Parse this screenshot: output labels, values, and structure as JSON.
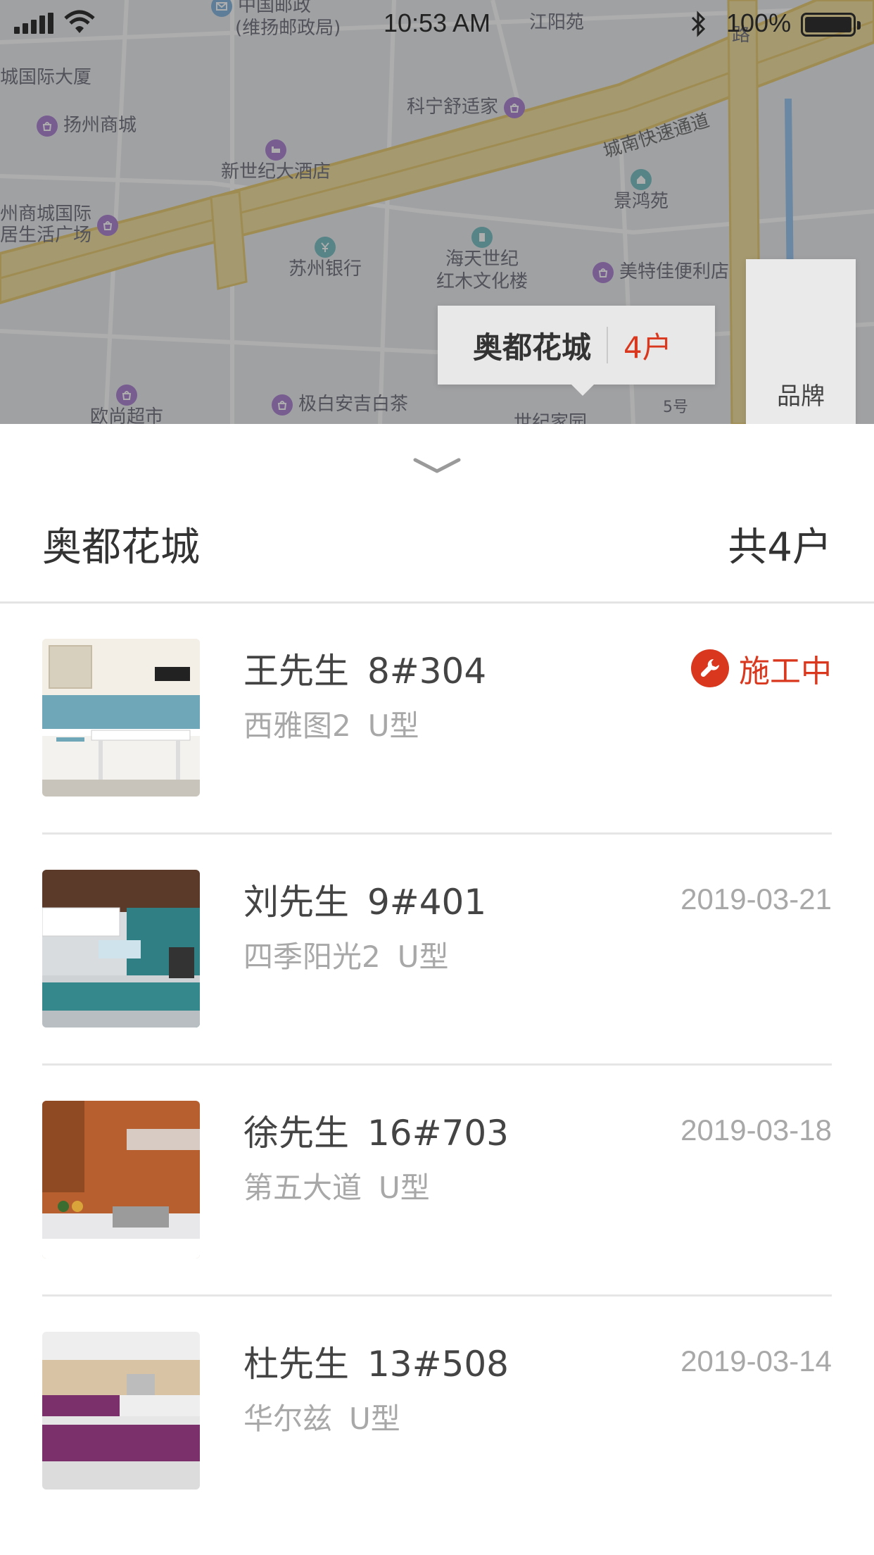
{
  "status_bar": {
    "time": "10:53 AM",
    "battery": "100%"
  },
  "map": {
    "pois": [
      {
        "label": "中国邮政",
        "label2": "(维扬邮政局)",
        "icon": "mail-icon"
      },
      {
        "label": "江阳苑"
      },
      {
        "label": "城国际大厦"
      },
      {
        "label": "扬州商城",
        "icon": "shop-icon"
      },
      {
        "label": "科宁舒适家",
        "icon": "shop-icon"
      },
      {
        "label": "新世纪大酒店",
        "icon": "hotel-icon"
      },
      {
        "label": "州商城国际",
        "label2": "居生活广场",
        "icon": "shop-icon"
      },
      {
        "label": "景鸿苑",
        "icon": "home-icon"
      },
      {
        "label": "苏州银行",
        "icon": "bank-icon"
      },
      {
        "label": "海天世纪",
        "label2": "红木文化楼",
        "icon": "building-icon"
      },
      {
        "label": "美特佳便利店",
        "icon": "shop-icon"
      },
      {
        "label": "欧尚超市",
        "icon": "shop-icon"
      },
      {
        "label": "极白安吉白茶",
        "icon": "shop-icon"
      },
      {
        "label": "世纪家园"
      },
      {
        "label": "5号"
      },
      {
        "label": "路"
      }
    ],
    "road_label": "城南快速通道",
    "callout": {
      "name": "奥都花城",
      "count": "4户"
    },
    "brand_label": "品牌"
  },
  "sheet": {
    "title": "奥都花城",
    "total": "共4户",
    "items": [
      {
        "name": "王先生",
        "unit": "8#304",
        "community": "西雅图2",
        "type": "U型",
        "status": "施工中",
        "date": ""
      },
      {
        "name": "刘先生",
        "unit": "9#401",
        "community": "四季阳光2",
        "type": "U型",
        "status": "",
        "date": "2019-03-21"
      },
      {
        "name": "徐先生",
        "unit": "16#703",
        "community": "第五大道",
        "type": "U型",
        "status": "",
        "date": "2019-03-18"
      },
      {
        "name": "杜先生",
        "unit": "13#508",
        "community": "华尔兹",
        "type": "U型",
        "status": "",
        "date": "2019-03-14"
      }
    ]
  },
  "colors": {
    "accent": "#d9381e",
    "text_primary": "#333333",
    "text_secondary": "#a8a8a8",
    "divider": "#e4e4e4"
  }
}
